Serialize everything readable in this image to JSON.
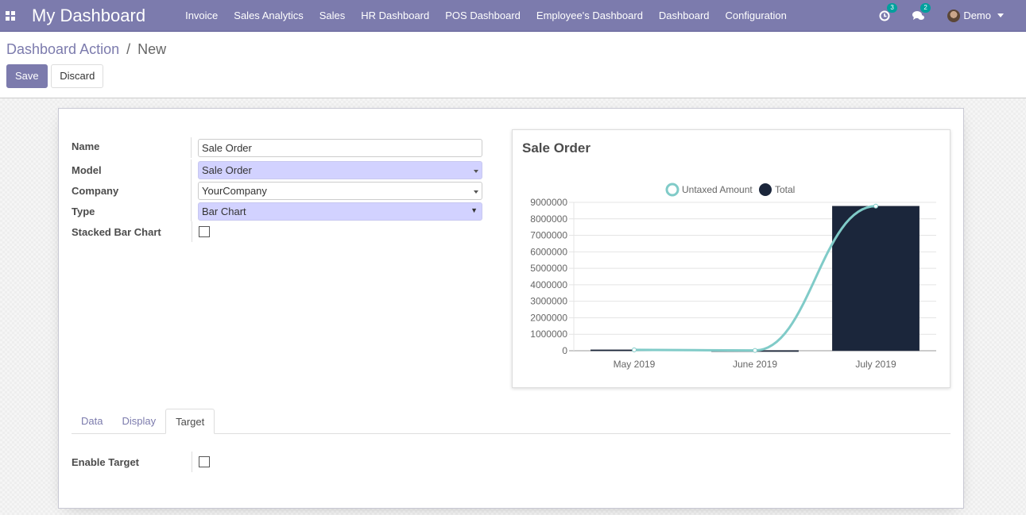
{
  "navbar": {
    "brand": "My Dashboard",
    "menu": [
      "Invoice",
      "Sales Analytics",
      "Sales",
      "HR Dashboard",
      "POS Dashboard",
      "Employee's Dashboard",
      "Dashboard",
      "Configuration"
    ],
    "activity_count": "3",
    "message_count": "2",
    "user": "Demo"
  },
  "breadcrumb": {
    "parent": "Dashboard Action",
    "separator": "/",
    "current": "New"
  },
  "buttons": {
    "save": "Save",
    "discard": "Discard"
  },
  "form": {
    "name_label": "Name",
    "name_value": "Sale Order",
    "model_label": "Model",
    "model_value": "Sale Order",
    "company_label": "Company",
    "company_value": "YourCompany",
    "type_label": "Type",
    "type_value": "Bar Chart",
    "stacked_label": "Stacked Bar Chart",
    "stacked_checked": false
  },
  "tabs": [
    "Data",
    "Display",
    "Target"
  ],
  "active_tab": "Target",
  "target": {
    "enable_label": "Enable Target",
    "enable_checked": false
  },
  "colors": {
    "navbar": "#7c7bad",
    "bar_total": "#1b263b",
    "line_untaxed": "#80cbc8",
    "badge": "#00a09d"
  },
  "chart_data": {
    "type": "bar",
    "title": "Sale Order",
    "categories": [
      "May 2019",
      "June 2019",
      "July 2019"
    ],
    "series": [
      {
        "name": "Untaxed Amount",
        "type": "line",
        "values": [
          52000,
          17000,
          8770000
        ]
      },
      {
        "name": "Total",
        "type": "bar",
        "values": [
          60000,
          20000,
          8770000
        ]
      }
    ],
    "yticks": [
      "0",
      "1000000",
      "2000000",
      "3000000",
      "4000000",
      "5000000",
      "6000000",
      "7000000",
      "8000000",
      "9000000"
    ],
    "ylim": [
      0,
      9000000
    ],
    "legend": "top-center",
    "grid": true
  }
}
